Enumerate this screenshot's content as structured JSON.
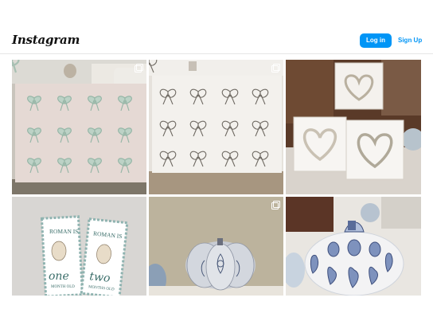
{
  "header": {
    "logo_text": "Instagram",
    "login_label": "Log in",
    "signup_label": "Sign Up",
    "accent_color": "#0095f6"
  },
  "posts": [
    {
      "subject": "canvas with painted bows in living room",
      "multi_icon": "carousel-icon"
    },
    {
      "subject": "canvas with sketched bows",
      "multi_icon": "carousel-icon"
    },
    {
      "subject": "small heart canvases on shelf",
      "multi_icon": "none"
    },
    {
      "subject": "puppy birthday cards",
      "multi_icon": "none"
    },
    {
      "subject": "blue and white painted pumpkin",
      "multi_icon": "carousel-icon"
    },
    {
      "subject": "chinoiserie pumpkin",
      "multi_icon": "none"
    }
  ],
  "cards": {
    "left": {
      "line1": "ROMAN IS",
      "line2": "one",
      "line3": "MONTH OLD"
    },
    "right": {
      "line1": "ROMAN IS",
      "line2": "two",
      "line3": "MONTHS OLD"
    }
  }
}
